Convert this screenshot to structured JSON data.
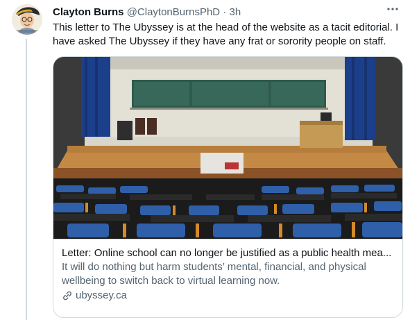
{
  "tweet": {
    "author_name": "Clayton Burns",
    "author_handle": "@ClaytonBurnsPhD",
    "separator": "·",
    "timestamp": "3h",
    "more_icon": "ellipsis-icon",
    "text": "This letter to The Ubyssey is at the head of the website as a tacit editorial. I have asked The Ubyssey if they have any frat or sorority people on staff."
  },
  "card": {
    "title": "Letter: Online school can no longer be justified as a public health mea...",
    "description": "It will do nothing but harm students’ mental, financial, and physical wellbeing to switch back to virtual learning now.",
    "domain": "ubyssey.ca",
    "domain_icon": "link-icon"
  },
  "colors": {
    "text_primary": "#0f1419",
    "text_secondary": "#536471",
    "border": "#cfd9de",
    "seat_blue": "#2f5fa8"
  }
}
